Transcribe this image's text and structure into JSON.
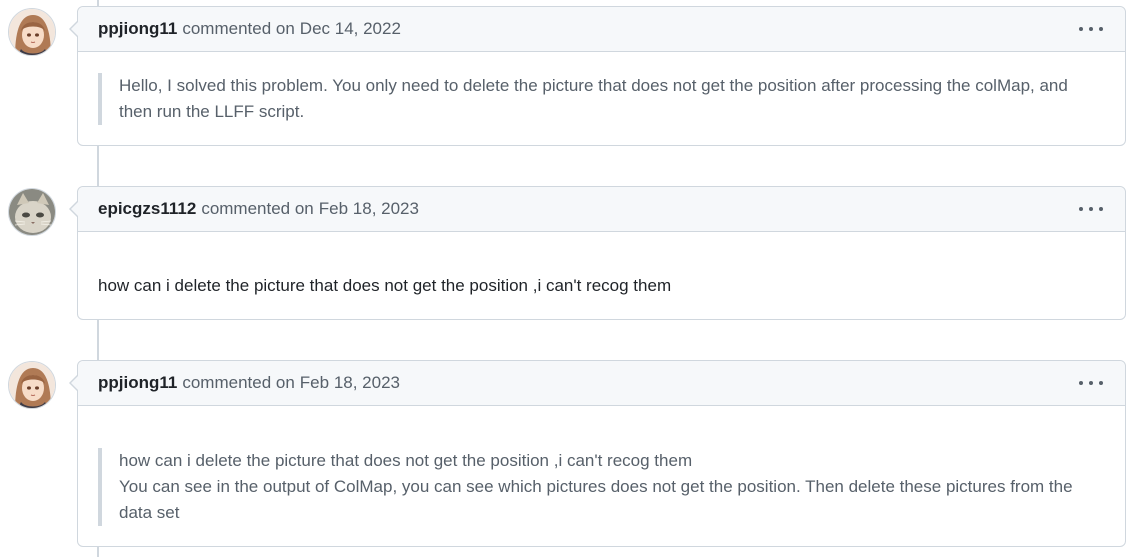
{
  "comments": [
    {
      "author": "ppjiong11",
      "action": "commented on",
      "date": "Dec 14, 2022",
      "quote_lines": [
        "Hello, I solved this problem. You only need to delete the picture that does not get the position after processing the colMap, and then run the LLFF script."
      ]
    },
    {
      "author": "epicgzs1112",
      "action": "commented on",
      "date": "Feb 18, 2023",
      "text": "how can i delete the picture that does not get the position ,i can't recog them"
    },
    {
      "author": "ppjiong11",
      "action": "commented on",
      "date": "Feb 18, 2023",
      "quote_lines": [
        "how can i delete the picture that does not get the position ,i can't recog them",
        "You can see in the output of ColMap, you can see which pictures does not get the position. Then delete these pictures from the data set"
      ]
    }
  ],
  "icons": {
    "menu": "kebab-horizontal-icon",
    "avatar_1": "anime-girl-avatar",
    "avatar_2": "cat-avatar",
    "avatar_3": "anime-girl-avatar"
  },
  "colors": {
    "border": "#d0d7de",
    "header_bg": "#f6f8fa",
    "muted_text": "#57606a",
    "text": "#1f2328"
  }
}
